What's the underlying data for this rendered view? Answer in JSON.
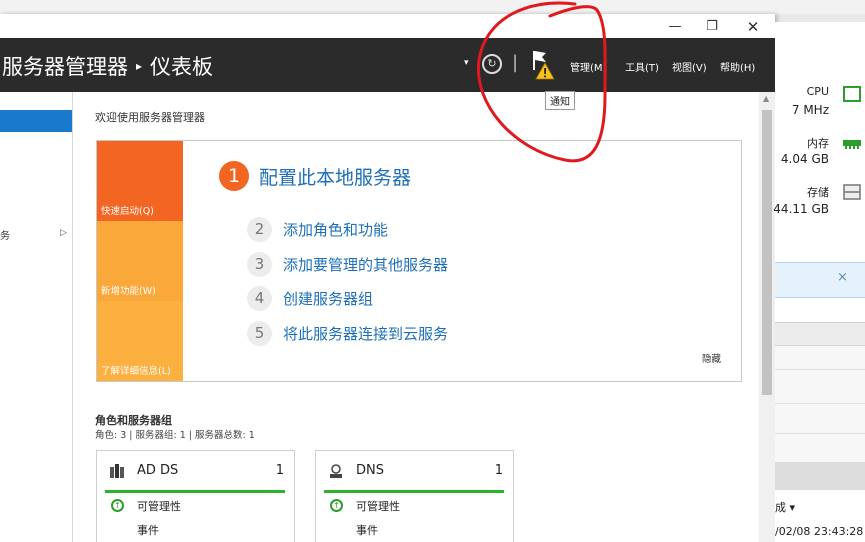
{
  "window": {
    "controls": {
      "minimize": "—",
      "maximize": "❐",
      "close": "✕"
    }
  },
  "header": {
    "breadcrumb_root": "服务器管理器",
    "breadcrumb_sep": "▸",
    "breadcrumb_page": "仪表板",
    "dropdown_glyph": "▾",
    "refresh_glyph": "↻",
    "pipe": "|",
    "menu": {
      "manage": "管理(M)",
      "tools": "工具(T)",
      "view": "视图(V)",
      "help": "帮助(H)"
    },
    "tooltip": "通知"
  },
  "sidebar": {
    "item_label": "务",
    "item_arrow": "▷"
  },
  "content": {
    "welcome": "欢迎使用服务器管理器",
    "tiles": {
      "quick_start": "快速启动(Q)",
      "whats_new": "新增功能(W)",
      "learn_more": "了解详细信息(L)"
    },
    "step1": {
      "num": "1",
      "label": "配置此本地服务器"
    },
    "steps": [
      {
        "num": "2",
        "label": "添加角色和功能"
      },
      {
        "num": "3",
        "label": "添加要管理的其他服务器"
      },
      {
        "num": "4",
        "label": "创建服务器组"
      },
      {
        "num": "5",
        "label": "将此服务器连接到云服务"
      }
    ],
    "hide": "隐藏",
    "roles_title": "角色和服务器组",
    "roles_sub": "角色: 3 | 服务器组: 1 | 服务器总数: 1",
    "cards": [
      {
        "title": "AD DS",
        "count": "1",
        "line1": "可管理性",
        "line2": "事件"
      },
      {
        "title": "DNS",
        "count": "1",
        "line1": "可管理性",
        "line2": "事件"
      }
    ],
    "ok_glyph": "↑"
  },
  "scrollbar": {
    "up": "▲"
  },
  "right_panel": {
    "cpu_label": "CPU",
    "cpu_value": "7 MHz",
    "mem_label": "内存",
    "mem_value": "4.04 GB",
    "storage_label": "存储",
    "storage_value": "44.11 GB",
    "close_glyph": "×",
    "status": "成 ▾",
    "timestamp": "/02/08 23:43:28"
  },
  "colors": {
    "accent_blue": "#1979ca",
    "header_bg": "#2b2b2b",
    "tile_orange": "#f26522",
    "tile_yellow": "#fba83a",
    "ok_green": "#2cb32c",
    "annotation_red": "#e0191f"
  }
}
